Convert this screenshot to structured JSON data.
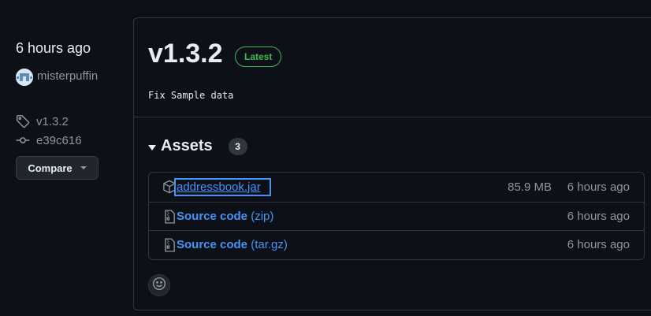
{
  "sidebar": {
    "time_ago": "6 hours ago",
    "author": "misterpuffin",
    "tag": "v1.3.2",
    "commit": "e39c616",
    "compare_label": "Compare"
  },
  "release": {
    "title": "v1.3.2",
    "badge": "Latest",
    "body": "Fix Sample data"
  },
  "assets": {
    "title": "Assets",
    "count": "3",
    "items": [
      {
        "name": "addressbook.jar",
        "ext": "",
        "size": "85.9 MB",
        "time": "6 hours ago",
        "icon": "package-icon"
      },
      {
        "name": "Source code",
        "ext": "(zip)",
        "size": "",
        "time": "6 hours ago",
        "icon": "file-zip-icon"
      },
      {
        "name": "Source code",
        "ext": "(tar.gz)",
        "size": "",
        "time": "6 hours ago",
        "icon": "file-zip-icon"
      }
    ]
  },
  "colors": {
    "background": "#0d1117",
    "link": "#4493f8",
    "latest_badge": "#3fb950",
    "muted_text": "#8d96a0",
    "border": "#30363d"
  }
}
